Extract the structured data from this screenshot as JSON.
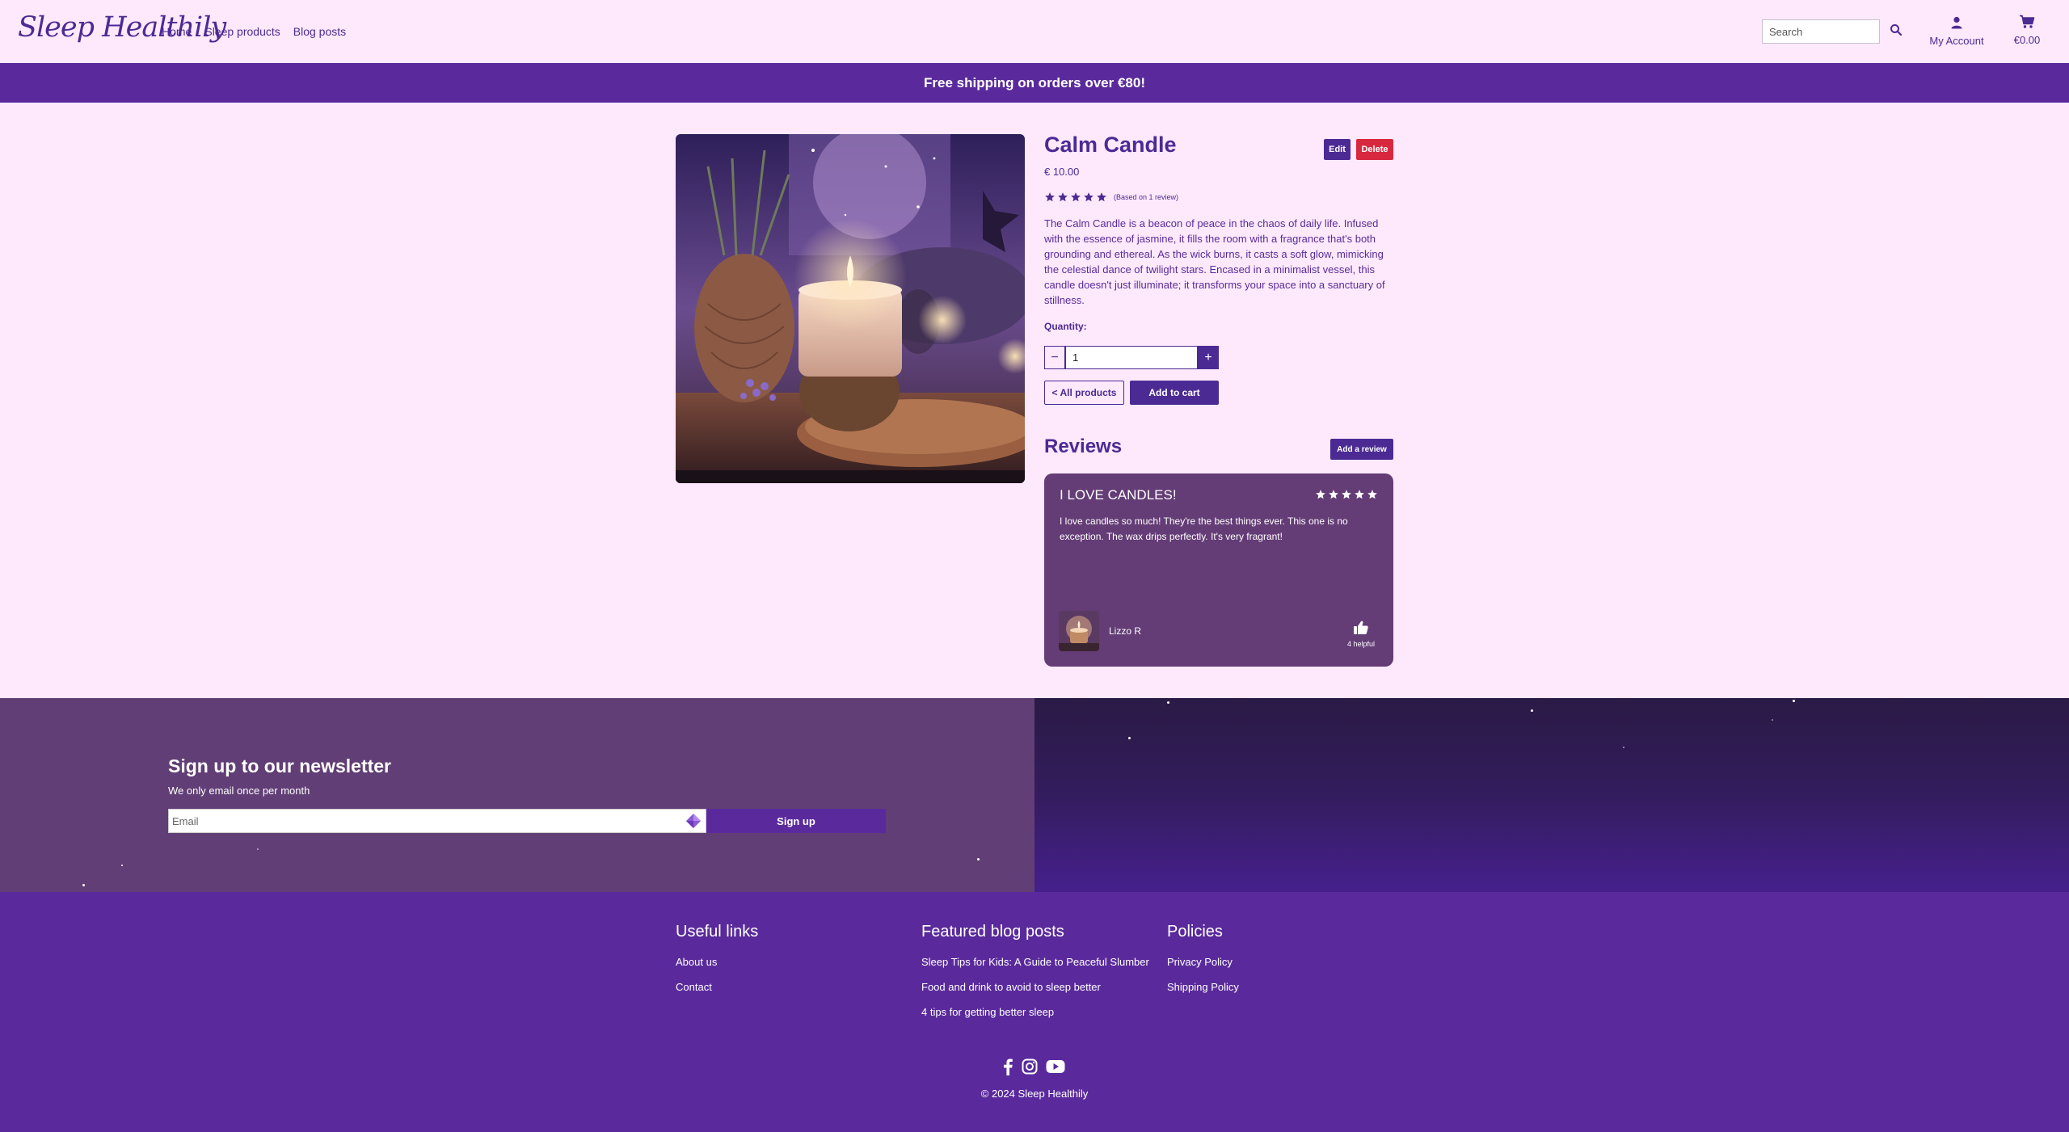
{
  "header": {
    "logo": "Sleep Healthily",
    "nav": [
      "Home",
      "Sleep products",
      "Blog posts"
    ],
    "search_placeholder": "Search",
    "account_label": "My Account",
    "cart_total": "€0.00"
  },
  "banner": {
    "text": "Free shipping on orders over €80!"
  },
  "product": {
    "title": "Calm Candle",
    "edit_label": "Edit",
    "delete_label": "Delete",
    "price": "€ 10.00",
    "rating": 5,
    "rating_note": "(Based on 1 review)",
    "description": "The Calm Candle is a beacon of peace in the chaos of daily life. Infused with the essence of jasmine, it fills the room with a fragrance that's both grounding and ethereal. As the wick burns, it casts a soft glow, mimicking the celestial dance of twilight stars. Encased in a minimalist vessel, this candle doesn't just illuminate; it transforms your space into a sanctuary of stillness.",
    "quantity_label": "Quantity:",
    "quantity_value": "1",
    "all_products_label": "< All products",
    "add_to_cart_label": "Add to cart"
  },
  "reviews": {
    "title": "Reviews",
    "add_review_label": "Add a review",
    "items": [
      {
        "title": "I LOVE CANDLES!",
        "rating": 5,
        "body": "I love candles so much! They're the best things ever. This one is no exception. The wax drips perfectly. It's very fragrant!",
        "author": "Lizzo R",
        "helpful": "4 helpful"
      }
    ]
  },
  "newsletter": {
    "title": "Sign up to our newsletter",
    "subtitle": "We only email once per month",
    "email_placeholder": "Email",
    "button_label": "Sign up"
  },
  "footer": {
    "columns": [
      {
        "title": "Useful links",
        "links": [
          "About us",
          "Contact"
        ]
      },
      {
        "title": "Featured blog posts",
        "links": [
          "Sleep Tips for Kids: A Guide to Peaceful Slumber",
          "Food and drink to avoid to sleep better",
          "4 tips for getting better sleep"
        ]
      },
      {
        "title": "Policies",
        "links": [
          "Privacy Policy",
          "Shipping Policy"
        ]
      }
    ],
    "social": [
      "facebook-icon",
      "instagram-icon",
      "youtube-icon"
    ],
    "copyright": "© 2024 Sleep Healthily"
  },
  "colors": {
    "page_bg": "#fde9fb",
    "brand_purple": "#5a2a9c",
    "text_purple": "#4c2a94",
    "review_card": "#643c76",
    "delete_red": "#d8283f"
  }
}
